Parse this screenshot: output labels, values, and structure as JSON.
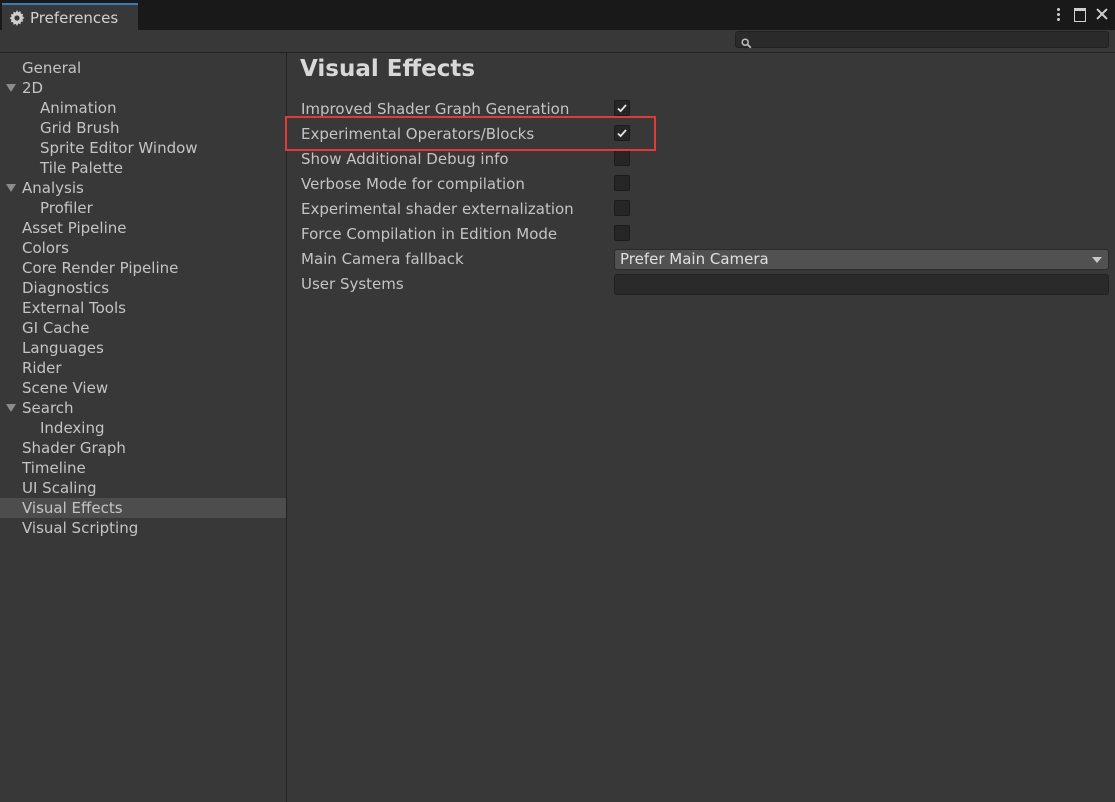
{
  "window": {
    "tab_title": "Preferences",
    "tab_icon": "gear-icon"
  },
  "search": {
    "value": "",
    "placeholder": ""
  },
  "sidebar": {
    "items": [
      {
        "label": "General",
        "level": 0
      },
      {
        "label": "2D",
        "level": 0,
        "expanded": true
      },
      {
        "label": "Animation",
        "level": 1
      },
      {
        "label": "Grid Brush",
        "level": 1
      },
      {
        "label": "Sprite Editor Window",
        "level": 1
      },
      {
        "label": "Tile Palette",
        "level": 1
      },
      {
        "label": "Analysis",
        "level": 0,
        "expanded": true
      },
      {
        "label": "Profiler",
        "level": 1
      },
      {
        "label": "Asset Pipeline",
        "level": 0
      },
      {
        "label": "Colors",
        "level": 0
      },
      {
        "label": "Core Render Pipeline",
        "level": 0
      },
      {
        "label": "Diagnostics",
        "level": 0
      },
      {
        "label": "External Tools",
        "level": 0
      },
      {
        "label": "GI Cache",
        "level": 0
      },
      {
        "label": "Languages",
        "level": 0
      },
      {
        "label": "Rider",
        "level": 0
      },
      {
        "label": "Scene View",
        "level": 0
      },
      {
        "label": "Search",
        "level": 0,
        "expanded": true
      },
      {
        "label": "Indexing",
        "level": 1
      },
      {
        "label": "Shader Graph",
        "level": 0
      },
      {
        "label": "Timeline",
        "level": 0
      },
      {
        "label": "UI Scaling",
        "level": 0
      },
      {
        "label": "Visual Effects",
        "level": 0,
        "selected": true
      },
      {
        "label": "Visual Scripting",
        "level": 0
      }
    ]
  },
  "main": {
    "title": "Visual Effects",
    "settings": [
      {
        "label": "Improved Shader Graph Generation",
        "type": "checkbox",
        "checked": true
      },
      {
        "label": "Experimental Operators/Blocks",
        "type": "checkbox",
        "checked": true,
        "highlighted": true
      },
      {
        "label": "Show Additional Debug info",
        "type": "checkbox",
        "checked": false
      },
      {
        "label": "Verbose Mode for compilation",
        "type": "checkbox",
        "checked": false
      },
      {
        "label": "Experimental shader externalization",
        "type": "checkbox",
        "checked": false
      },
      {
        "label": "Force Compilation in Edition Mode",
        "type": "checkbox",
        "checked": false
      },
      {
        "label": "Main Camera fallback",
        "type": "dropdown",
        "value": "Prefer Main Camera"
      },
      {
        "label": "User Systems",
        "type": "text",
        "value": ""
      }
    ]
  },
  "colors": {
    "background": "#383838",
    "titlebar": "#191919",
    "tab_accent": "#3a79bb",
    "selection": "#4d4d4d",
    "highlight_box": "#e03a3a"
  }
}
